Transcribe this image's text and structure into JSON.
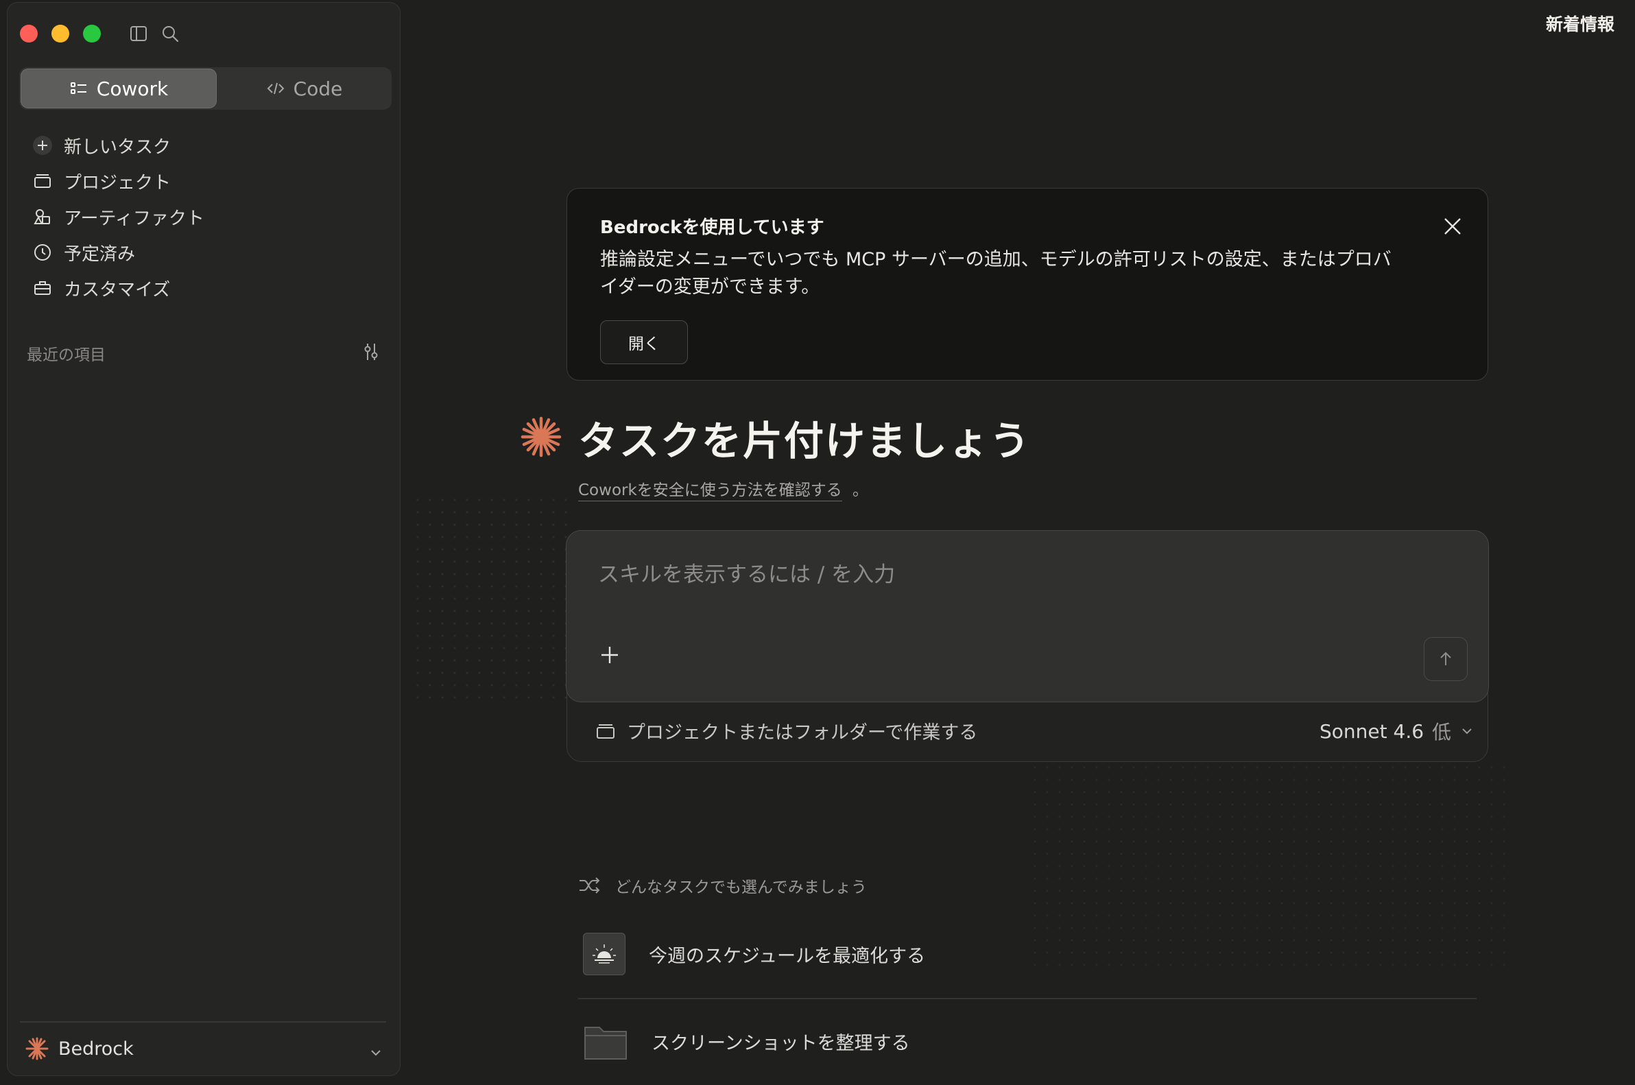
{
  "window": {
    "whats_new": "新着情報"
  },
  "sidebar": {
    "mode_tabs": [
      {
        "label": "Cowork",
        "active": true
      },
      {
        "label": "Code",
        "active": false
      }
    ],
    "nav_items": [
      {
        "label": "新しいタスク",
        "icon": "plus-icon"
      },
      {
        "label": "プロジェクト",
        "icon": "folder-icon"
      },
      {
        "label": "アーティファクト",
        "icon": "shapes-icon"
      },
      {
        "label": "予定済み",
        "icon": "clock-icon"
      },
      {
        "label": "カスタマイズ",
        "icon": "briefcase-icon"
      }
    ],
    "recent_label": "最近の項目",
    "account_name": "Bedrock"
  },
  "banner": {
    "title": "Bedrockを使用しています",
    "body": "推論設定メニューでいつでも MCP サーバーの追加、モデルの許可リストの設定、またはプロバイダーの変更ができます。",
    "open_button": "開く"
  },
  "main": {
    "heading": "タスクを片付けましょう",
    "subtext_link": "Coworkを安全に使う方法を確認する",
    "subtext_end": "。"
  },
  "composer": {
    "placeholder": "スキルを表示するには / を入力",
    "project_label": "プロジェクトまたはフォルダーで作業する",
    "model": "Sonnet 4.6",
    "effort": "低"
  },
  "suggestions": {
    "label": "どんなタスクでも選んでみましょう",
    "items": [
      {
        "label": "今週のスケジュールを最適化する",
        "icon": "sunrise-icon"
      },
      {
        "label": "スクリーンショットを整理する",
        "icon": "folder-icon"
      }
    ]
  },
  "colors": {
    "accent": "#d97757",
    "background": "#1f1f1e",
    "close": "#ff5f57",
    "minimize": "#febc2e",
    "maximize": "#28c840"
  }
}
